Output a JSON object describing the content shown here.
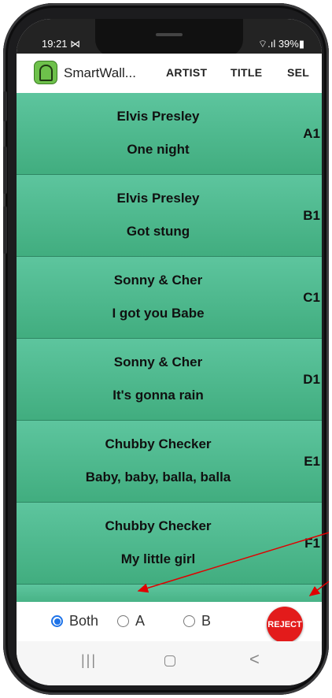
{
  "status": {
    "time": "19:21 ⋈",
    "right": "⌔.ıl 39%▮"
  },
  "appbar": {
    "title": "SmartWall...",
    "tabs": [
      "ARTIST",
      "TITLE",
      "SEL"
    ]
  },
  "rows": [
    {
      "artist": "Elvis Presley",
      "song": "One night",
      "code": "A1"
    },
    {
      "artist": "Elvis Presley",
      "song": "Got stung",
      "code": "B1"
    },
    {
      "artist": "Sonny & Cher",
      "song": "I got you Babe",
      "code": "C1"
    },
    {
      "artist": "Sonny & Cher",
      "song": "It's gonna rain",
      "code": "D1"
    },
    {
      "artist": "Chubby Checker",
      "song": "Baby, baby, balla, balla",
      "code": "E1"
    },
    {
      "artist": "Chubby Checker",
      "song": "My little girl",
      "code": "F1"
    }
  ],
  "controls": {
    "options": [
      {
        "label": "Both",
        "selected": true
      },
      {
        "label": "A",
        "selected": false
      },
      {
        "label": "B",
        "selected": false
      }
    ],
    "reject_label": "REJECT"
  },
  "colors": {
    "row_green": "#4cb98b",
    "reject_red": "#e31b1b",
    "radio_blue": "#1e73e8",
    "arrow_red": "#e00000"
  },
  "navbar": {
    "icons": [
      "recents-icon",
      "home-icon",
      "back-icon"
    ],
    "recents": "|||",
    "back": "<"
  }
}
